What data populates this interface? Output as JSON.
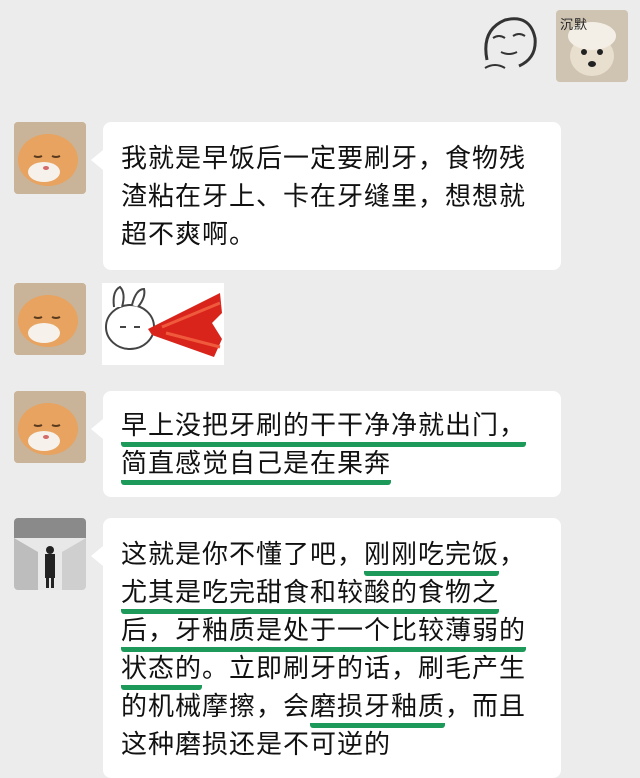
{
  "top": {
    "avatar_badge": "沉默"
  },
  "messages": [
    {
      "id": "m1",
      "lines": [
        "我就是早饭后一定要刷牙，食物残",
        "渣粘在牙上、卡在牙缝里，想想就",
        "超不爽啊。"
      ]
    },
    {
      "id": "m3",
      "lines": [
        "早上没把牙刷的干干净净就出门，",
        "简直感觉自己是在果奔"
      ]
    },
    {
      "id": "m4",
      "segments": [
        [
          "这就是你不懂了吧，",
          "刚刚吃完饭",
          "，"
        ],
        [
          "尤其是吃完甜食和较酸的食物之"
        ],
        [
          "后，牙釉质是处于一个比较薄弱的"
        ],
        [
          "状态的",
          "。立即刷牙的话，刷毛产生"
        ],
        [
          "的机械摩擦，会",
          "磨损牙釉质",
          "，而且"
        ],
        [
          "这种磨损还是不可逆的"
        ]
      ]
    }
  ],
  "colors": {
    "background": "#ececec",
    "bubble": "#ffffff",
    "underline": "#1d9a5a"
  },
  "icons": [
    "face-sticker",
    "dog-avatar",
    "cat-avatar",
    "rabbit-sticker",
    "person-avatar"
  ]
}
